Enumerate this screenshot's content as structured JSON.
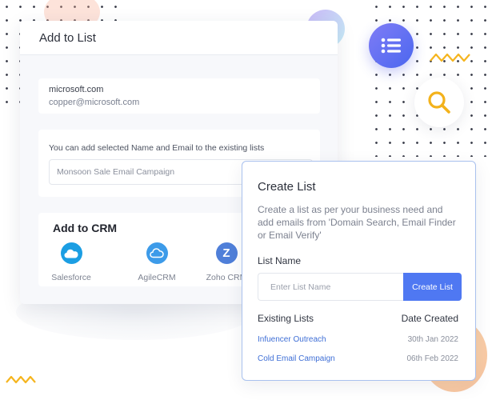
{
  "add_to_list": {
    "title": "Add to List",
    "domain": "microsoft.com",
    "email": "copper@microsoft.com",
    "lists_hint": "You can add selected Name and Email to the existing lists",
    "selected_list": "Monsoon Sale Email Campaign"
  },
  "crm": {
    "title": "Add to CRM",
    "items": [
      {
        "label": "Salesforce",
        "icon": "salesforce-cloud-icon",
        "color": "#1b9ee3"
      },
      {
        "label": "AgileCRM",
        "icon": "agilecrm-cloud-icon",
        "color": "#3d9be9"
      },
      {
        "label": "Zoho CRM",
        "icon": "zoho-z-icon",
        "color": "#4f7fd9",
        "glyph": "Z"
      }
    ]
  },
  "create_list": {
    "title": "Create List",
    "description": "Create a list as per your business need and add emails from 'Domain Search, Email Finder or Email Verify'",
    "name_label": "List Name",
    "name_placeholder": "Enter List Name",
    "button_label": "Create List",
    "existing_header": "Existing Lists",
    "date_header": "Date Created",
    "lists": [
      {
        "name": "Infuencer Outreach",
        "date": "30th Jan 2022"
      },
      {
        "name": "Cold Email Campaign",
        "date": "06th Feb 2022"
      }
    ]
  },
  "decor": {
    "list_icon": "list-icon",
    "search_icon": "search-icon",
    "accent": "#4f78f2",
    "search_color": "#f3b21b"
  }
}
